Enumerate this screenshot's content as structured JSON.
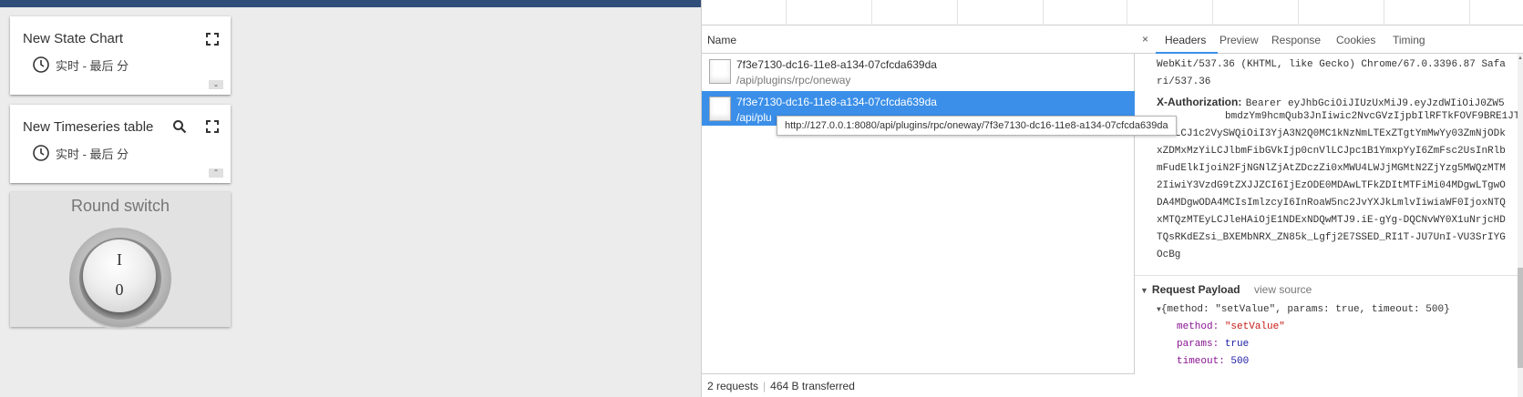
{
  "dashboard": {
    "state_chart": {
      "title": "New State Chart",
      "time_label": "实时 - 最后 分",
      "fullscreen_icon": "fullscreen-icon",
      "scroll_glyph": "⌄"
    },
    "timeseries": {
      "title": "New Timeseries table",
      "time_label": "实时 - 最后 分",
      "search_icon": "search-icon",
      "fullscreen_icon": "fullscreen-icon",
      "scroll_glyph": "⌃"
    },
    "round_switch": {
      "title": "Round switch",
      "on_label": "I",
      "off_label": "0"
    }
  },
  "devtools": {
    "list": {
      "column_name": "Name",
      "requests": [
        {
          "name": "7f3e7130-dc16-11e8-a134-07cfcda639da",
          "path": "/api/plugins/rpc/oneway",
          "selected": false
        },
        {
          "name": "7f3e7130-dc16-11e8-a134-07cfcda639da",
          "path": "/api/plu",
          "selected": true
        }
      ],
      "tooltip": "http://127.0.0.1:8080/api/plugins/rpc/oneway/7f3e7130-dc16-11e8-a134-07cfcda639da",
      "status": {
        "requests": "2 requests",
        "transferred": "464 B transferred",
        "separator": "|"
      }
    },
    "details": {
      "close_glyph": "×",
      "tabs": [
        "Headers",
        "Preview",
        "Response",
        "Cookies",
        "Timing"
      ],
      "active_tab": "Headers",
      "headers_lines": [
        "WebKit/537.36 (KHTML, like Gecko) Chrome/67.0.3396.87 Safa",
        "ri/537.36"
      ],
      "auth_key": "X-Authorization:",
      "auth_first": "Bearer eyJhbGciOiJIUzUxMiJ9.eyJzdWIiOiJ0ZW5",
      "auth_lines": [
        "bmdzYm9hcmQub3JnIiwic2NvcGVzIjpbIlRFTkFOVF9BRE1JT",
        "iJdLCJ1c2VySWQiOiI3YjA3N2Q0MC1kNzNmLTExZTgtYmMwYy03ZmNjODk",
        "xZDMxMzYiLCJlbmFibGVkIjp0cnVlLCJpc1B1YmxpYyI6ZmFsc2UsInRlb",
        "mFudElkIjoiN2FjNGNlZjAtZDczZi0xMWU4LWJjMGMtN2ZjYzg5MWQzMTM",
        "2IiwiY3VzdG9tZXJJZCI6IjEzODE0MDAwLTFkZDItMTFiMi04MDgwLTgwO",
        "DA4MDgwODA4MCIsImlzcyI6InRoaW5nc2JvYXJkLmlvIiwiaWF0IjoxNTQ",
        "xMTQzMTEyLCJleHAiOjE1NDExNDQwMTJ9.iE-gYg-DQCNvWY0X1uNrjcHD",
        "TQsRKdEZsi_BXEMbNRX_ZN85k_Lgfj2E7SSED_RI1T-JU7UnI-VU3SrIYG",
        "OcBg"
      ],
      "payload": {
        "section_title": "Request Payload",
        "view_source": "view source",
        "summary": "{method: \"setValue\", params: true, timeout: 500}",
        "fields": [
          {
            "key": "method:",
            "value": "\"setValue\"",
            "kind": "str"
          },
          {
            "key": "params:",
            "value": "true",
            "kind": "kw"
          },
          {
            "key": "timeout:",
            "value": "500",
            "kind": "kw"
          }
        ]
      }
    }
  },
  "colors": {
    "selection": "#3b8fe8",
    "topbar": "#2f4e7a",
    "key_purple": "#881391",
    "string_red": "#c41a16",
    "keyword_blue": "#1a1aa6"
  }
}
